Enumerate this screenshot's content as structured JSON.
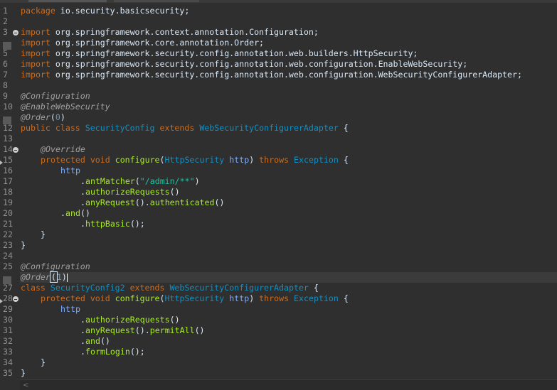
{
  "colors": {
    "background": "#2f2f2f",
    "keyword": "#cc6c1d",
    "class_name": "#1290c3",
    "method": "#a7ec21",
    "string": "#17c6a3",
    "annotation": "#a0a0a0",
    "text": "#d9e8f7"
  },
  "editor": {
    "line_numbers": [
      "1",
      "2",
      "3",
      "4",
      "5",
      "6",
      "7",
      "8",
      "9",
      "10",
      "11",
      "12",
      "13",
      "14",
      "15",
      "16",
      "17",
      "18",
      "19",
      "20",
      "21",
      "22",
      "23",
      "24",
      "25",
      "26",
      "27",
      "28",
      "29",
      "30",
      "31",
      "32",
      "33",
      "34",
      "35"
    ],
    "lines": {
      "l1": {
        "k": "package",
        "t": " io.security.basicsecurity;"
      },
      "l3": {
        "k": "import",
        "t": " org.springframework.context.annotation.Configuration;"
      },
      "l4": {
        "k": "import",
        "t": " org.springframework.core.annotation.Order;"
      },
      "l5": {
        "k": "import",
        "t": " org.springframework.security.config.annotation.web.builders.HttpSecurity;"
      },
      "l6": {
        "k": "import",
        "t": " org.springframework.security.config.annotation.web.configuration.EnableWebSecurity;"
      },
      "l7": {
        "k": "import",
        "t": " org.springframework.security.config.annotation.web.configuration.WebSecurityConfigurerAdapter;"
      },
      "l9": {
        "a": "@Configuration"
      },
      "l10": {
        "a": "@EnableWebSecurity"
      },
      "l11": {
        "a": "@Order",
        "p1": "(",
        "n": "0",
        "p2": ")"
      },
      "l12": {
        "k1": "public",
        "s1": " ",
        "k2": "class",
        "s2": " ",
        "c1": "SecurityConfig",
        "s3": " ",
        "k3": "extends",
        "s4": " ",
        "c2": "WebSecurityConfigurerAdapter",
        "e": " {"
      },
      "l14": {
        "a": "@Override"
      },
      "l15": {
        "k1": "protected",
        "s1": " ",
        "k2": "void",
        "s2": " ",
        "m": "configure",
        "p1": "(",
        "c1": "HttpSecurity",
        "s3": " ",
        "v": "http",
        "p2": ") ",
        "k3": "throws",
        "s4": " ",
        "c2": "Exception",
        "e": " {"
      },
      "l16": {
        "v": "http"
      },
      "l17": {
        "p1": ".",
        "m": "antMatcher",
        "p2": "(",
        "s": "\"/admin/**\"",
        "p3": ")"
      },
      "l18": {
        "p1": ".",
        "m": "authorizeRequests",
        "p2": "()"
      },
      "l19": {
        "p1": ".",
        "m1": "anyRequest",
        "p2": "().",
        "m2": "authenticated",
        "p3": "()"
      },
      "l20": {
        "p1": ".",
        "m": "and",
        "p2": "()"
      },
      "l21": {
        "p1": ".",
        "m": "httpBasic",
        "p2": "();"
      },
      "l22": {
        "t": "}"
      },
      "l23": {
        "t": "}"
      },
      "l25": {
        "a": "@Configuration"
      },
      "l26": {
        "a": "@Order",
        "p1": "(",
        "n": "1",
        "p2": ")"
      },
      "l27": {
        "k1": "class",
        "s1": " ",
        "c1": "SecurityConfig2",
        "s2": " ",
        "k2": "extends",
        "s3": " ",
        "c2": "WebSecurityConfigurerAdapter",
        "e": " {"
      },
      "l28": {
        "k1": "protected",
        "s1": " ",
        "k2": "void",
        "s2": " ",
        "m": "configure",
        "p1": "(",
        "c1": "HttpSecurity",
        "s3": " ",
        "v": "http",
        "p2": ") ",
        "k3": "throws",
        "s4": " ",
        "c2": "Exception",
        "e": " {"
      },
      "l29": {
        "v": "http"
      },
      "l30": {
        "p1": ".",
        "m": "authorizeRequests",
        "p2": "()"
      },
      "l31": {
        "p1": ".",
        "m1": "anyRequest",
        "p2": "().",
        "m2": "permitAll",
        "p3": "()"
      },
      "l32": {
        "p1": ".",
        "m": "and",
        "p2": "()"
      },
      "l33": {
        "p1": ".",
        "m": "formLogin",
        "p2": "();"
      },
      "l34": {
        "t": "}"
      },
      "l35": {
        "t": "}"
      }
    }
  },
  "scrollbar": {
    "left_arrow": "<"
  }
}
